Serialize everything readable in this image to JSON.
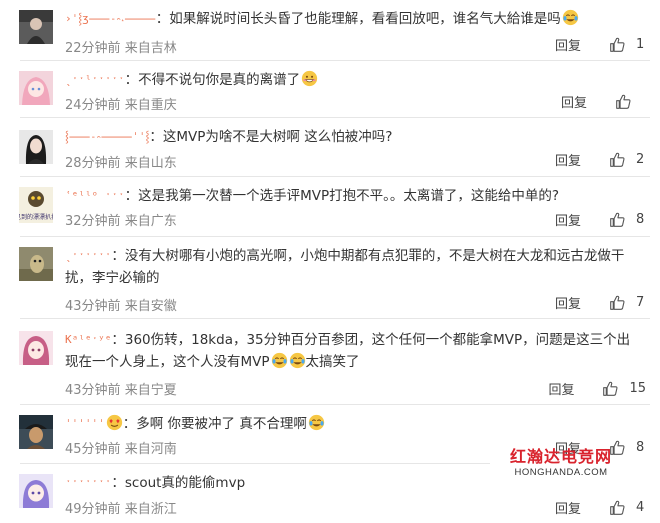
{
  "reply_label": "回复",
  "comments": [
    {
      "username": "›ˈ⸾ʒ⸺˗⹅˔⸻",
      "text": "如果解说时间长头昏了也能理解，看看回放吧，谁名气大給谁是吗",
      "emoji": "cry-laugh",
      "time": "22分钟前",
      "location": "来自吉林",
      "likes": "1"
    },
    {
      "username": "ˎˑˑˡˑˑˑˑˑ",
      "text": "不得不说句你是真的离谱了",
      "emoji": "grin",
      "time": "24分钟前",
      "location": "来自重庆",
      "likes": ""
    },
    {
      "username": "⸾⸺˗⹅⸻ˈˈ⸾",
      "text": "这MVP为啥不是大树啊 这么怕被冲吗?",
      "emoji": "",
      "time": "28分钟前",
      "location": "来自山东",
      "likes": "2"
    },
    {
      "username": "ʿᵉˡˡᵒ ˑˑˑ",
      "text": "这是我第一次替一个选手评MVP打抱不平。。太离谱了，这能给中单的?",
      "emoji": "",
      "time": "32分钟前",
      "location": "来自广东",
      "likes": "8"
    },
    {
      "username": "ˎˑˑˑˑˑˑ",
      "text": "没有大树哪有小炮的高光啊，小炮中期都有点犯罪的，不是大树在大龙和远古龙做干扰，李宁必输的",
      "emoji": "",
      "time": "43分钟前",
      "location": "来自安徽",
      "likes": "7"
    },
    {
      "username": "Kᵃˡᵉˑʸᵉ",
      "text": "360伤转，18kda，35分钟百分百参团，这个任何一个都能拿MVP，问题是这三个出现在一个人身上，这个人没有MVP",
      "emoji": "cry-laugh-double",
      "tail": "太搞笑了",
      "time": "43分钟前",
      "location": "来自宁夏",
      "likes": "15"
    },
    {
      "username": "ˈˈˈˈˈˈ",
      "prefix_emoji": "heart-eyes",
      "text": "多啊 你要被冲了 真不合理啊",
      "emoji": "cry-laugh",
      "time": "45分钟前",
      "location": "来自河南",
      "likes": "8"
    },
    {
      "username": "ˑˑˑˑˑˑˑ",
      "text": "scout真的能偷mvp",
      "emoji": "",
      "time": "49分钟前",
      "location": "来自浙江",
      "likes": "4"
    }
  ],
  "watermark": {
    "title": "红瀚达电竞网",
    "url": "HONGHANDA.COM"
  },
  "avatar_label": "见到的漂漂扒扎"
}
